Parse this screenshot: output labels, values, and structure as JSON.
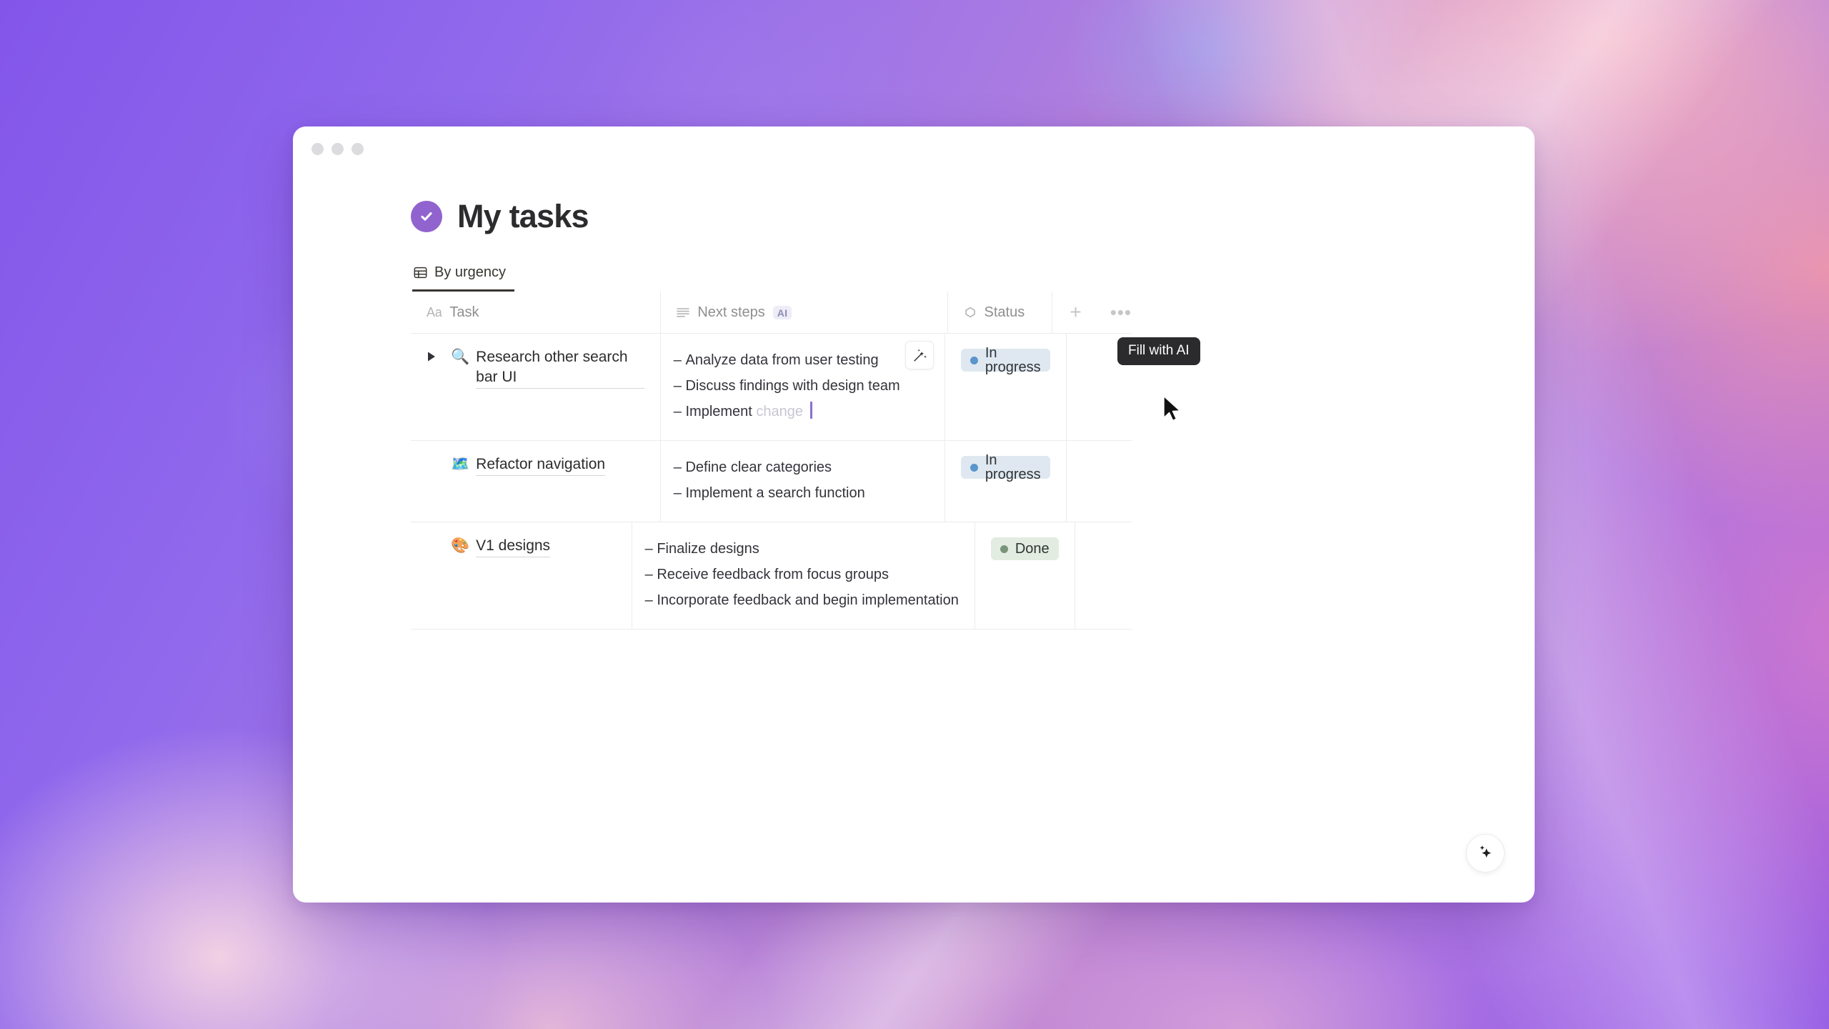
{
  "window": {
    "traffic_lights": [
      "close",
      "minimize",
      "zoom"
    ]
  },
  "page": {
    "title": "My tasks",
    "title_icon": "check-circle-icon"
  },
  "tabs": [
    {
      "label": "By urgency",
      "icon": "table-icon",
      "active": true
    }
  ],
  "table": {
    "columns": [
      {
        "key": "task",
        "label": "Task",
        "icon": "aa-text-icon"
      },
      {
        "key": "steps",
        "label": "Next steps",
        "icon": "lines-icon",
        "badge": "AI"
      },
      {
        "key": "status",
        "label": "Status",
        "icon": "select-icon"
      }
    ],
    "actions": {
      "add_label": "+",
      "more_label": "•••"
    },
    "rows": [
      {
        "emoji": "🔍",
        "task": "Research other search bar UI",
        "has_disclosure": true,
        "steps": [
          {
            "text": "Analyze data from user testing",
            "state": "complete"
          },
          {
            "text": "Discuss findings with design team",
            "state": "complete"
          },
          {
            "text": "Implement",
            "tail": " change",
            "state": "generating"
          }
        ],
        "status": {
          "label": "In progress",
          "variant": "inprogress"
        },
        "ai_button": {
          "name": "fill-with-ai-button",
          "tooltip": "Fill with AI"
        }
      },
      {
        "emoji": "🗺️",
        "task": "Refactor navigation",
        "has_disclosure": false,
        "steps": [
          {
            "text": "Define clear categories",
            "state": "complete"
          },
          {
            "text": "Implement a search function",
            "state": "complete"
          }
        ],
        "status": {
          "label": "In progress",
          "variant": "inprogress"
        }
      },
      {
        "emoji": "🎨",
        "task": "V1 designs",
        "has_disclosure": false,
        "steps": [
          {
            "text": "Finalize designs",
            "state": "complete"
          },
          {
            "text": "Receive feedback from focus groups",
            "state": "complete"
          },
          {
            "text": "Incorporate feedback and begin implementation",
            "state": "complete"
          }
        ],
        "status": {
          "label": "Done",
          "variant": "done"
        }
      }
    ]
  },
  "fab": {
    "icon": "sparkles-icon"
  },
  "colors": {
    "accent_purple": "#9163cf",
    "ai_caret": "#8b6fd4",
    "status_inprogress_bg": "#dfe8f0",
    "status_inprogress_dot": "#5a95cb",
    "status_done_bg": "#e3ece0",
    "status_done_dot": "#79947a",
    "tooltip_bg": "#2b2b2e"
  }
}
